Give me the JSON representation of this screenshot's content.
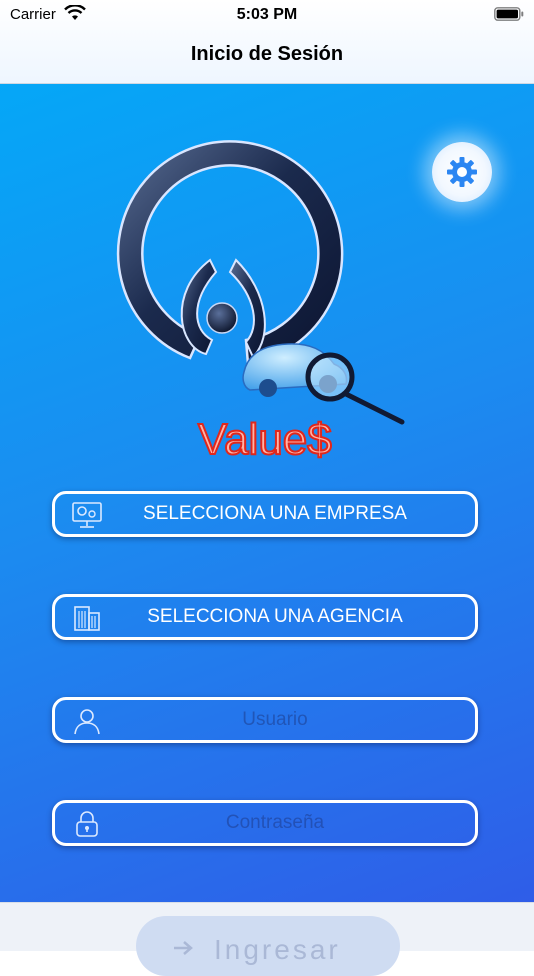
{
  "status_bar": {
    "carrier": "Carrier",
    "time": "5:03 PM"
  },
  "nav": {
    "title": "Inicio de Sesión"
  },
  "logo": {
    "text": "Value$"
  },
  "company_button": {
    "label": "SELECCIONA UNA EMPRESA",
    "icon": "monitor-gear-icon"
  },
  "agency_button": {
    "label": "SELECCIONA UNA AGENCIA",
    "icon": "building-icon"
  },
  "username_field": {
    "placeholder": "Usuario",
    "icon": "user-icon",
    "value": ""
  },
  "password_field": {
    "placeholder": "Contraseña",
    "icon": "lock-icon",
    "value": ""
  },
  "login_button": {
    "label": "Ingresar"
  },
  "colors": {
    "bg_top": "#05a7f7",
    "bg_bottom": "#2f5de8",
    "accent": "#2a78f0",
    "field_border": "#ffffff"
  }
}
